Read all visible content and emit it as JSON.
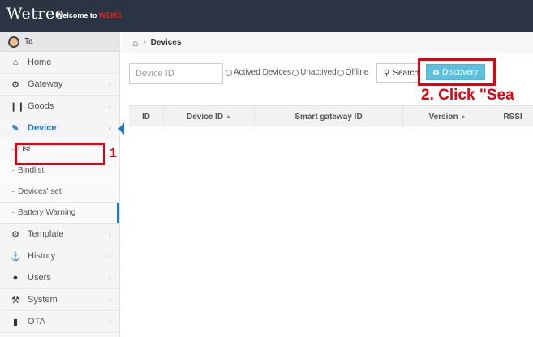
{
  "app": {
    "logo": "Wetree",
    "welcome_prefix": "Welcome to ",
    "welcome_brand": "WEMS",
    "brand_color": "#e2231a",
    "topbar_color": "#2b3443"
  },
  "sidebar": {
    "user_name": "Ta",
    "items": [
      {
        "label": "Home",
        "icon": "home-icon",
        "has_chevron": false
      },
      {
        "label": "Gateway",
        "icon": "gateway-icon",
        "has_chevron": true
      },
      {
        "label": "Goods",
        "icon": "barcode-icon",
        "has_chevron": true
      },
      {
        "label": "Device",
        "icon": "device-icon",
        "has_chevron": true,
        "active": true
      }
    ],
    "sub_items": [
      {
        "label": "List",
        "selected": true
      },
      {
        "label": "Bindlist"
      },
      {
        "label": "Devices' set"
      },
      {
        "label": "Battery Warning"
      }
    ],
    "items_after": [
      {
        "label": "Template",
        "icon": "gears-icon"
      },
      {
        "label": "History",
        "icon": "anchor-icon"
      },
      {
        "label": "Users",
        "icon": "user-icon"
      },
      {
        "label": "System",
        "icon": "wrench-icon"
      },
      {
        "label": "OTA",
        "icon": "ota-icon"
      }
    ],
    "accent_color": "#1e77c9"
  },
  "breadcrumb": {
    "current": "Devices"
  },
  "filters": {
    "device_id_placeholder": "Device ID",
    "radios": [
      "Actived Devices",
      "Unactived",
      "Offline"
    ],
    "search_label": "Search",
    "discovery_label": "Discovery",
    "discovery_color": "#5bc0de"
  },
  "table": {
    "columns": [
      "ID",
      "Device ID",
      "Smart gateway ID",
      "Version",
      "RSSI"
    ]
  },
  "annotations": {
    "step1": "1",
    "step2": "2. Click \"Sea",
    "color": "#e3000f"
  }
}
